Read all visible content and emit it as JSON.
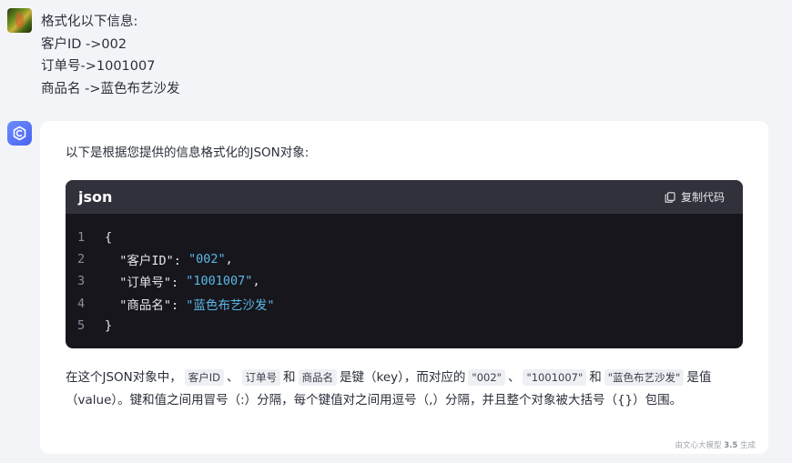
{
  "user": {
    "lines": [
      "格式化以下信息:",
      "客户ID ->002",
      "订单号->1001007",
      "商品名 ->蓝色布艺沙发"
    ]
  },
  "bot": {
    "intro": "以下是根据您提供的信息格式化的JSON对象:",
    "code": {
      "language": "json",
      "copy_label": "复制代码",
      "lines": [
        {
          "num": "1",
          "parts": [
            {
              "t": "{",
              "k": "punct"
            }
          ]
        },
        {
          "num": "2",
          "parts": [
            {
              "t": "  \"客户ID\": ",
              "k": "punct"
            },
            {
              "t": "\"002\"",
              "k": "str"
            },
            {
              "t": ",",
              "k": "punct"
            }
          ]
        },
        {
          "num": "3",
          "parts": [
            {
              "t": "  \"订单号\": ",
              "k": "punct"
            },
            {
              "t": "\"1001007\"",
              "k": "str"
            },
            {
              "t": ",",
              "k": "punct"
            }
          ]
        },
        {
          "num": "4",
          "parts": [
            {
              "t": "  \"商品名\": ",
              "k": "punct"
            },
            {
              "t": "\"蓝色布艺沙发\"",
              "k": "str"
            }
          ]
        },
        {
          "num": "5",
          "parts": [
            {
              "t": "}",
              "k": "punct"
            }
          ]
        }
      ]
    },
    "explanation": {
      "p1": "在这个JSON对象中，",
      "chip1": "客户ID",
      "sep1": "、",
      "chip2": "订单号",
      "and1": "和",
      "chip3": "商品名",
      "p2": "是键（key），而对应的",
      "chip4": "\"002\"",
      "sep2": "、",
      "chip5": "\"1001007\"",
      "and2": "和",
      "chip6": "\"蓝色布艺沙发\"",
      "p3": "是值（value）。键和值之间用冒号（:）分隔，每个键值对之间用逗号（,）分隔，并且整个对象被大括号（{}）包围。"
    },
    "footer": {
      "prefix": "由文心大模型",
      "version": "3.5",
      "suffix": "生成"
    }
  }
}
